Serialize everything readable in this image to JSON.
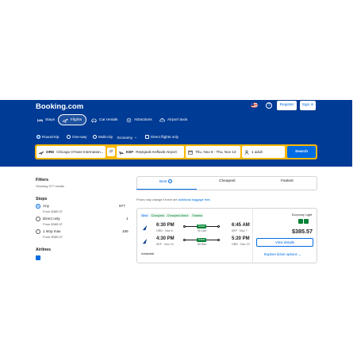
{
  "header": {
    "logo": "Booking.com",
    "register_label": "Register",
    "signin_label": "Sign in"
  },
  "nav": {
    "stays": "Stays",
    "flights": "Flights",
    "car_rentals": "Car rentals",
    "attractions": "Attractions",
    "airport_taxis": "Airport taxis"
  },
  "trip_options": {
    "round_trip": "Round-trip",
    "one_way": "One-way",
    "multi_city": "Multi-city",
    "cabin": "Economy",
    "direct_only": "Direct flights only"
  },
  "search": {
    "from_code": "ORD",
    "from_name": "Chicago O'Hare Internation...",
    "to_code": "KEF",
    "to_name": "Reykjavik Keflavik Airport",
    "dates": "Thu, Nov 6 - Thu, Nov 13",
    "travelers": "1 adult",
    "search_label": "Search"
  },
  "filters": {
    "title": "Filters",
    "showing": "Showing 977 results",
    "stops_title": "Stops",
    "stops": [
      {
        "label": "Any",
        "from": "From $385.57",
        "count": "977"
      },
      {
        "label": "Direct only",
        "from": "From $385.57",
        "count": "1"
      },
      {
        "label": "1 stop max",
        "from": "From $385.57",
        "count": "185"
      }
    ],
    "airlines_title": "Airlines"
  },
  "tabs": {
    "best": "Best",
    "cheapest": "Cheapest",
    "fastest": "Fastest"
  },
  "notice": {
    "text": "Prices may change if there are",
    "link": "additional baggage fees"
  },
  "result": {
    "badges": [
      "Best",
      "Cheapest",
      "Cheapest direct",
      "Fastest"
    ],
    "outbound": {
      "depart_time": "6:30 PM",
      "depart_info": "ORD · Nov 6",
      "stop": "Direct",
      "duration": "9h 15m",
      "arrive_time": "6:45 AM",
      "arrive_info": "KEF · Nov 7"
    },
    "return": {
      "depart_time": "4:30 PM",
      "depart_info": "KEF · Nov 13",
      "stop": "Direct",
      "duration": "6h 50m",
      "arrive_time": "5:20 PM",
      "arrive_info": "ORD · Nov 13"
    },
    "carrier": "Icelandair",
    "fare_class": "Economy Light",
    "price": "$385.57",
    "view_label": "View details",
    "explore_label": "Explore ticket options"
  },
  "colors": {
    "brand_blue": "#003b95",
    "action_blue": "#006ce4",
    "search_border": "#ffb700",
    "direct_green": "#008234"
  }
}
